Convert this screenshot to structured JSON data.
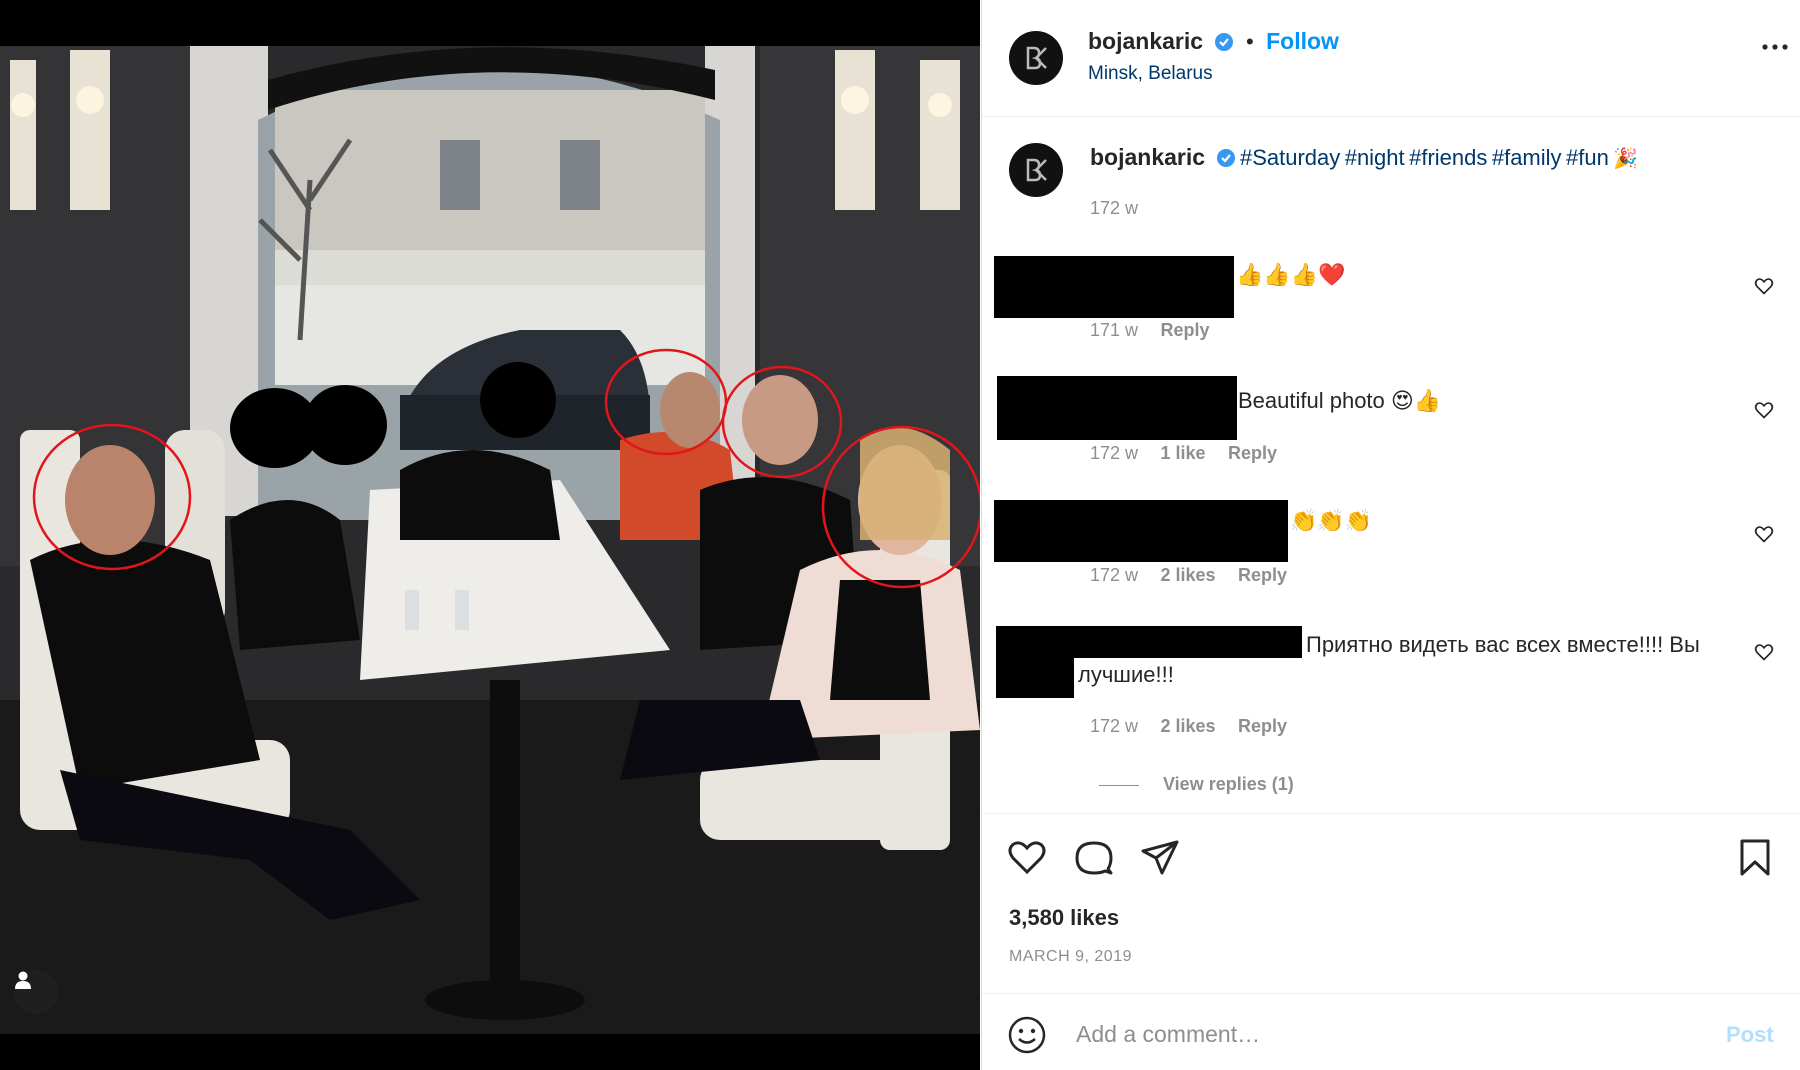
{
  "post": {
    "username": "bojankaric",
    "follow_label": "Follow",
    "location": "Minsk, Belarus",
    "caption_tags": [
      "#Saturday",
      "#night",
      "#friends",
      "#family",
      "#fun"
    ],
    "caption_emoji": "🎉",
    "caption_time": "172 w"
  },
  "comments": [
    {
      "text": "👍👍👍❤️",
      "time": "171 w",
      "likes": "",
      "reply": "Reply"
    },
    {
      "text": "Beautiful photo 😍👍",
      "time": "172 w",
      "likes": "1 like",
      "reply": "Reply"
    },
    {
      "text": "👏👏👏",
      "time": "172 w",
      "likes": "2 likes",
      "reply": "Reply"
    },
    {
      "text_line1": "Приятно видеть вас всех вместе!!!! Вы",
      "text_line2": "лучшие!!!",
      "time": "172 w",
      "likes": "2 likes",
      "reply": "Reply"
    }
  ],
  "view_replies": "View replies (1)",
  "likes_count": "3,580 likes",
  "post_date": "MARCH 9, 2019",
  "add_comment": {
    "placeholder": "Add a comment…",
    "post_label": "Post"
  },
  "colors": {
    "accent": "#0095f6",
    "verified": "#3897f0",
    "highlight_circle": "#e0161b"
  },
  "icons": [
    "heart-icon",
    "comment-icon",
    "share-icon",
    "bookmark-icon",
    "more-options-icon",
    "emoji-icon",
    "tagged-user-icon"
  ]
}
